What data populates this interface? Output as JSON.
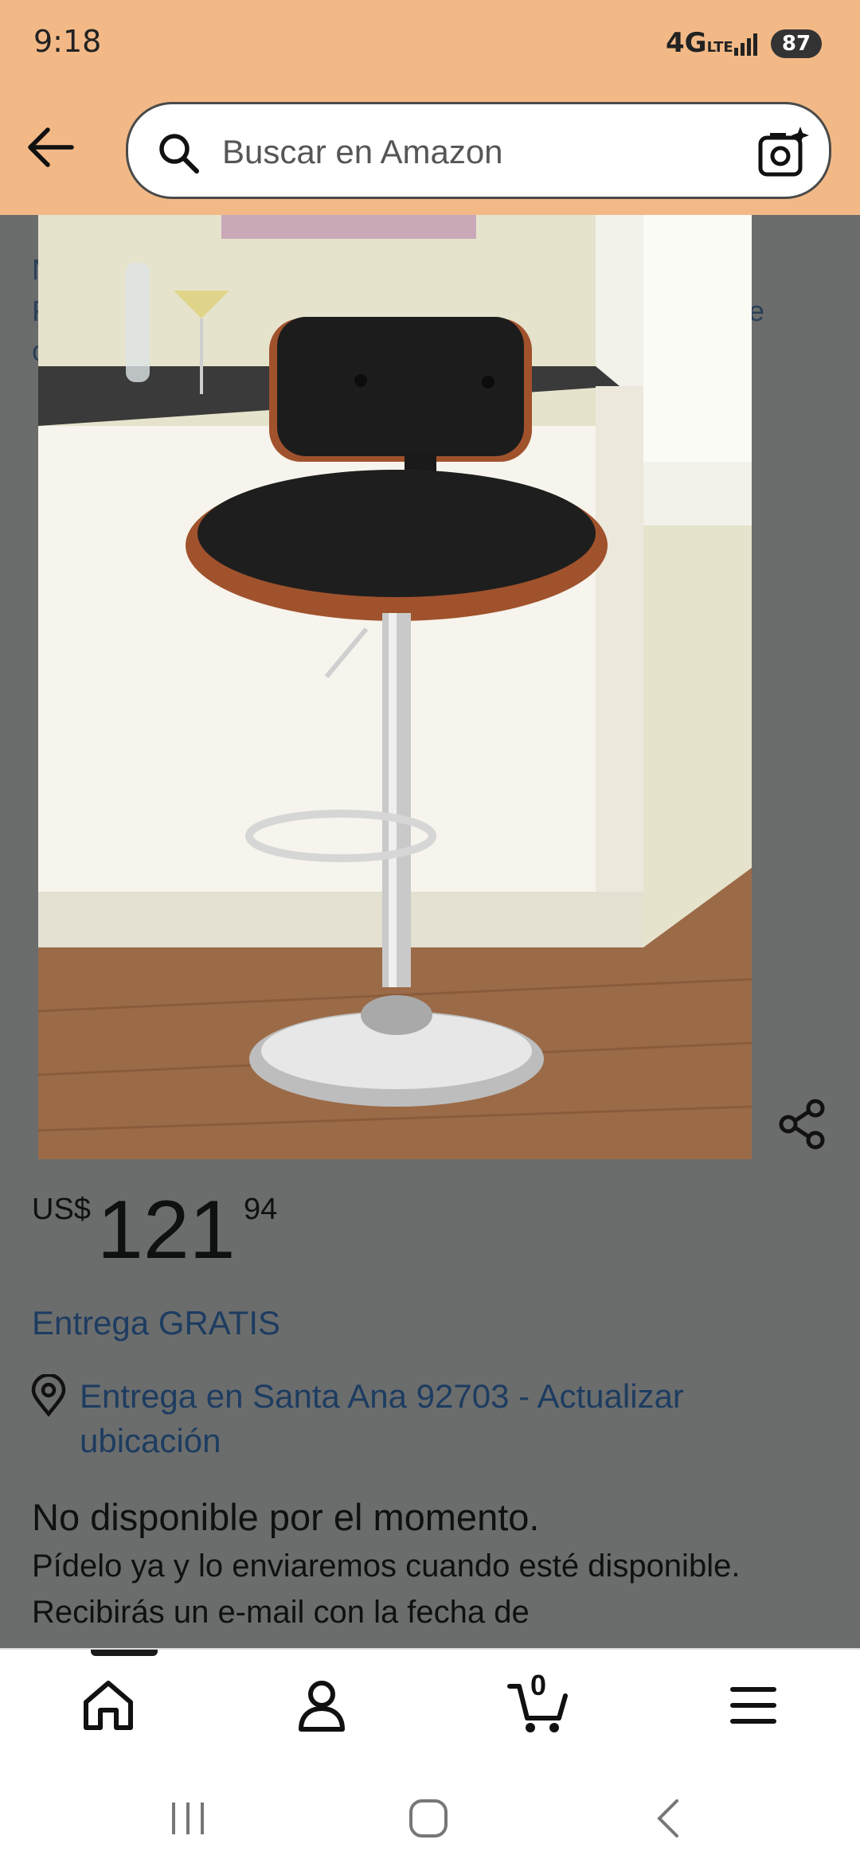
{
  "status": {
    "time": "9:18",
    "network": "4G",
    "network_sub": "LTE",
    "battery": "87"
  },
  "search": {
    "placeholder": "Buscar en Amazon"
  },
  "price": {
    "currency": "US$",
    "whole": "121",
    "fraction": "94"
  },
  "delivery": {
    "free_label": "Entrega GRATIS",
    "location_label": "Entrega en Santa Ana 92703 - Actualizar ubicación"
  },
  "availability": {
    "title": "No disponible por el momento.",
    "description": "Pídelo ya y lo enviaremos cuando esté disponible. Recibirás un e-mail con la fecha de"
  },
  "nav": {
    "cart_count": "0",
    "items": [
      "home-icon",
      "account-icon",
      "cart-icon",
      "menu-icon"
    ]
  },
  "colors": {
    "header": "#f2b987",
    "link": "#1d3c60",
    "overlay": "#6b6d6d"
  }
}
